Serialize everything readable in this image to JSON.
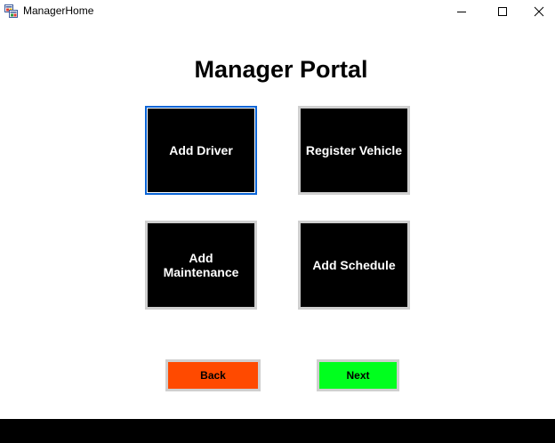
{
  "window": {
    "title": "ManagerHome",
    "controls": {
      "minimize_icon": "minimize-icon",
      "maximize_icon": "maximize-icon",
      "close_icon": "close-icon"
    }
  },
  "main": {
    "title": "Manager Portal",
    "tiles": [
      {
        "label": "Add Driver"
      },
      {
        "label": "Register Vehicle"
      },
      {
        "label": "Add\nMaintenance"
      },
      {
        "label": "Add Schedule"
      }
    ]
  },
  "nav": {
    "back_label": "Back",
    "next_label": "Next"
  },
  "colors": {
    "tile_background": "#000000",
    "tile_text": "#ffffff",
    "focus_border": "#0a64d6",
    "back_button": "#ff4a00",
    "next_button": "#00ff1e",
    "bottom_band": "#000000"
  }
}
